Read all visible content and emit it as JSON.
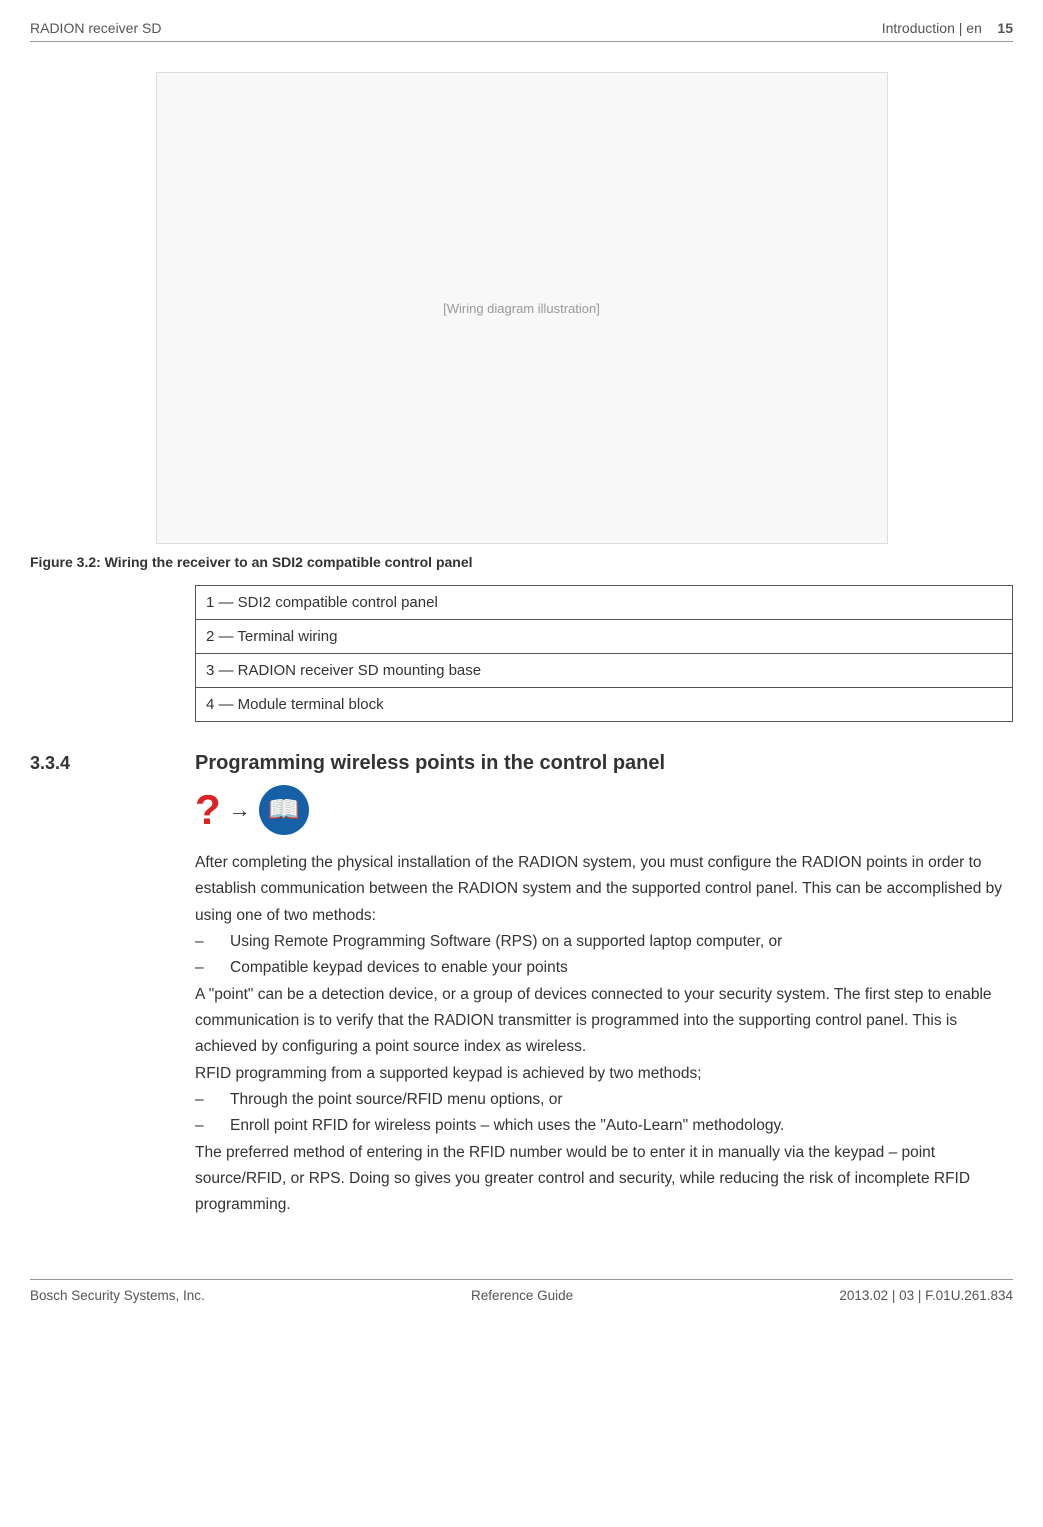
{
  "header": {
    "left": "RADION receiver SD",
    "right_label": "Introduction | en",
    "page_num": "15"
  },
  "figure": {
    "placeholder": "[Wiring diagram illustration]",
    "caption": "Figure 3.2: Wiring the receiver to an SDI2 compatible control panel"
  },
  "legend": [
    "1 ― SDI2 compatible control panel",
    "2 ― Terminal wiring",
    "3 ― RADION receiver SD mounting base",
    "4 ― Module terminal block"
  ],
  "section": {
    "number": "3.3.4",
    "title": "Programming wireless points in the control panel"
  },
  "para1a": "After completing the physical installation of the RADION system, you must configure the RADION points in order to establish communication between the RADION system and the supported control panel. This can be accomplished by using one of two methods:",
  "bullets1": [
    "Using Remote Programming Software (RPS) on a supported laptop computer, or",
    "Compatible keypad devices to enable your points"
  ],
  "para2": "A \"point\" can be a detection device, or a group of devices connected to your security system. The first step to enable communication is to verify that the RADION transmitter is programmed into the supporting control panel. This is achieved by configuring a point source index as wireless.",
  "para3": "RFID programming from a supported keypad is achieved by two methods;",
  "bullets2": [
    "Through the point source/RFID menu options, or",
    "Enroll point RFID for wireless points – which uses the \"Auto-Learn\" methodology."
  ],
  "para4": "The preferred method of entering in the RFID number would be to enter it in manually via the keypad – point source/RFID, or RPS. Doing so gives you greater control and security, while reducing the risk of incomplete RFID programming.",
  "footer": {
    "left": "Bosch Security Systems, Inc.",
    "center": "Reference Guide",
    "right": "2013.02 | 03 | F.01U.261.834"
  }
}
